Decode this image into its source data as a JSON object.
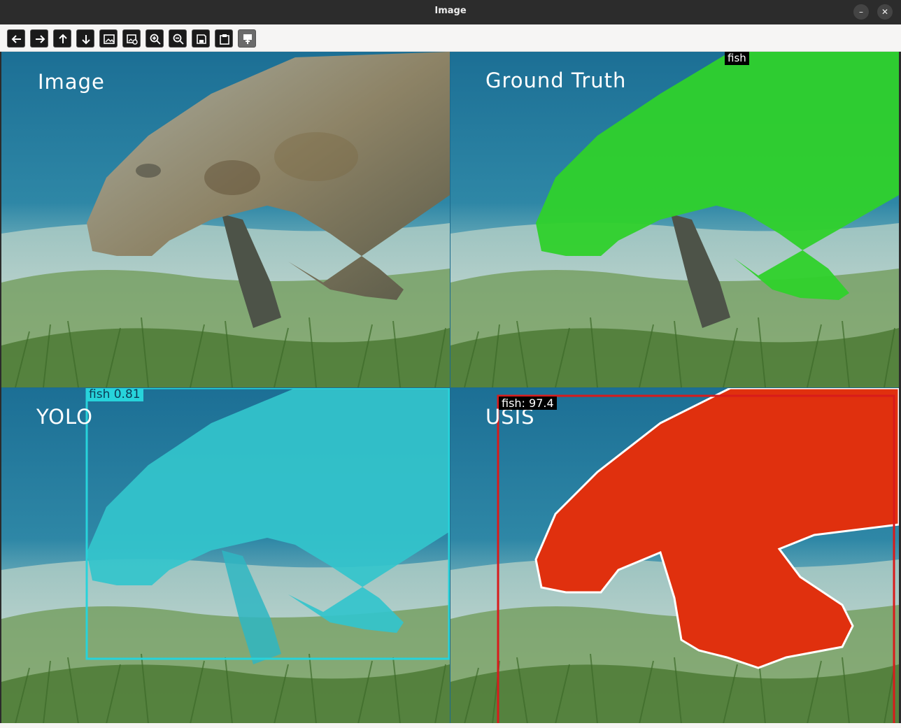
{
  "window": {
    "title": "Image",
    "minimize_glyph": "–",
    "close_glyph": "✕"
  },
  "toolbar": {
    "buttons": [
      {
        "icon": "arrow-left-icon"
      },
      {
        "icon": "arrow-right-icon"
      },
      {
        "icon": "arrow-up-icon"
      },
      {
        "icon": "arrow-down-icon"
      },
      {
        "icon": "image-icon"
      },
      {
        "icon": "image-settings-icon"
      },
      {
        "icon": "zoom-in-icon"
      },
      {
        "icon": "zoom-out-icon"
      },
      {
        "icon": "save-icon"
      },
      {
        "icon": "clipboard-icon"
      },
      {
        "icon": "properties-icon"
      }
    ]
  },
  "panels": {
    "image": {
      "label": "Image"
    },
    "ground_truth": {
      "label": "Ground Truth",
      "tag": "fish",
      "mask_color": "#2fd12b"
    },
    "yolo": {
      "label": "YOLO",
      "tag": "fish  0.81",
      "color": "#27d3db"
    },
    "usis": {
      "label": "USIS",
      "tag": "fish: 97.4",
      "color": "#e0300e",
      "box_color": "#d81b1b"
    }
  },
  "colors": {
    "water": "#1f7899",
    "sand": "#c9d6cf",
    "grass": "#5c8a3d",
    "manatee": "#8a8f80"
  }
}
